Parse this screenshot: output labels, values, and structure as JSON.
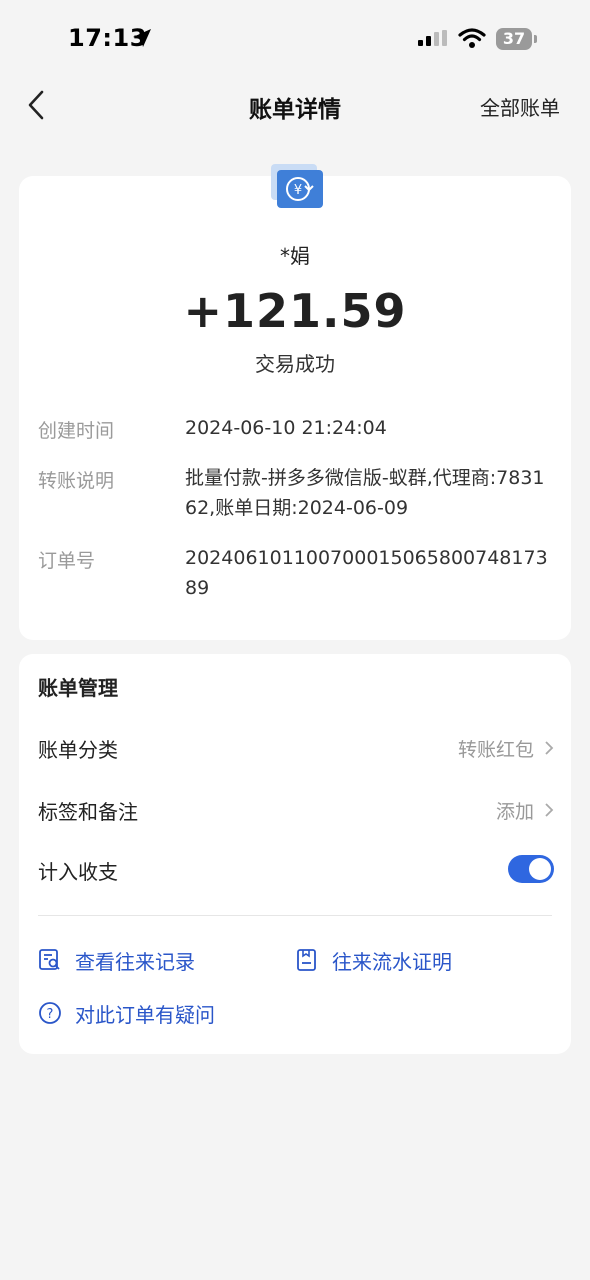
{
  "status_bar": {
    "time": "17:13",
    "battery": "37"
  },
  "nav": {
    "title": "账单详情",
    "right_link": "全部账单"
  },
  "transaction": {
    "name": "*娟",
    "amount": "+121.59",
    "status": "交易成功",
    "details": [
      {
        "label": "创建时间",
        "value": "2024-06-10 21:24:04"
      },
      {
        "label": "转账说明",
        "value": "批量付款-拼多多微信版-蚁群,代理商:783162,账单日期:2024-06-09"
      },
      {
        "label": "订单号",
        "value": "20240610110070001506580074817389"
      }
    ]
  },
  "management": {
    "title": "账单管理",
    "category_label": "账单分类",
    "category_value": "转账红包",
    "tags_label": "标签和备注",
    "tags_value": "添加",
    "include_label": "计入收支",
    "include_enabled": true,
    "links": {
      "records": "查看往来记录",
      "proof": "往来流水证明",
      "question": "对此订单有疑问"
    }
  },
  "colors": {
    "accent": "#2f67e0",
    "link": "#2a56c9",
    "background": "#f4f4f4"
  }
}
